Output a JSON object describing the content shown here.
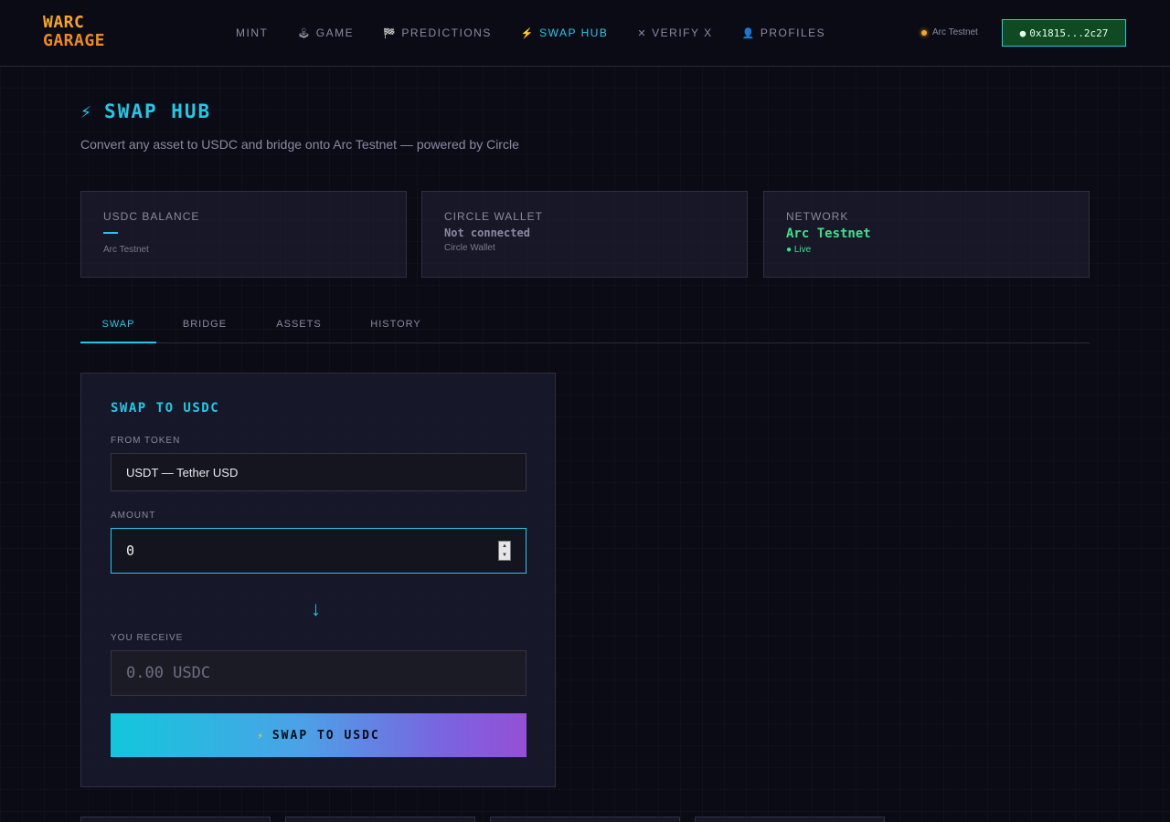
{
  "logo": {
    "line1": "WARC",
    "line2": "GARAGE"
  },
  "nav": {
    "items": [
      {
        "label": "MINT",
        "icon": ""
      },
      {
        "label": "GAME",
        "icon": "🕹"
      },
      {
        "label": "PREDICTIONS",
        "icon": "🏁"
      },
      {
        "label": "SWAP HUB",
        "icon": "⚡"
      },
      {
        "label": "VERIFY X",
        "icon": "✕"
      },
      {
        "label": "PROFILES",
        "icon": "👤"
      }
    ],
    "network_label": "Arc Testnet",
    "wallet_address": "0x1815...2c27"
  },
  "header": {
    "title": "SWAP HUB",
    "subtitle": "Convert any asset to USDC and bridge onto Arc Testnet — powered by Circle"
  },
  "cards": [
    {
      "label": "USDC BALANCE",
      "sub": "Arc Testnet"
    },
    {
      "label": "CIRCLE WALLET",
      "value": "Not connected",
      "sub": "Circle Wallet"
    },
    {
      "label": "NETWORK",
      "value": "Arc Testnet",
      "sub": "● Live"
    }
  ],
  "tabs": [
    {
      "label": "SWAP"
    },
    {
      "label": "BRIDGE"
    },
    {
      "label": "ASSETS"
    },
    {
      "label": "HISTORY"
    }
  ],
  "swap": {
    "title": "SWAP TO USDC",
    "from_label": "FROM TOKEN",
    "from_value": "USDT — Tether USD",
    "amount_label": "AMOUNT",
    "amount_value": "0",
    "receive_label": "YOU RECEIVE",
    "receive_value": "0.00 USDC",
    "button_label": "SWAP TO USDC"
  },
  "colors": {
    "accent": "#22c8e6",
    "logo": "#f6a623",
    "network_green": "#3ee08a",
    "background": "#0b0b16"
  }
}
